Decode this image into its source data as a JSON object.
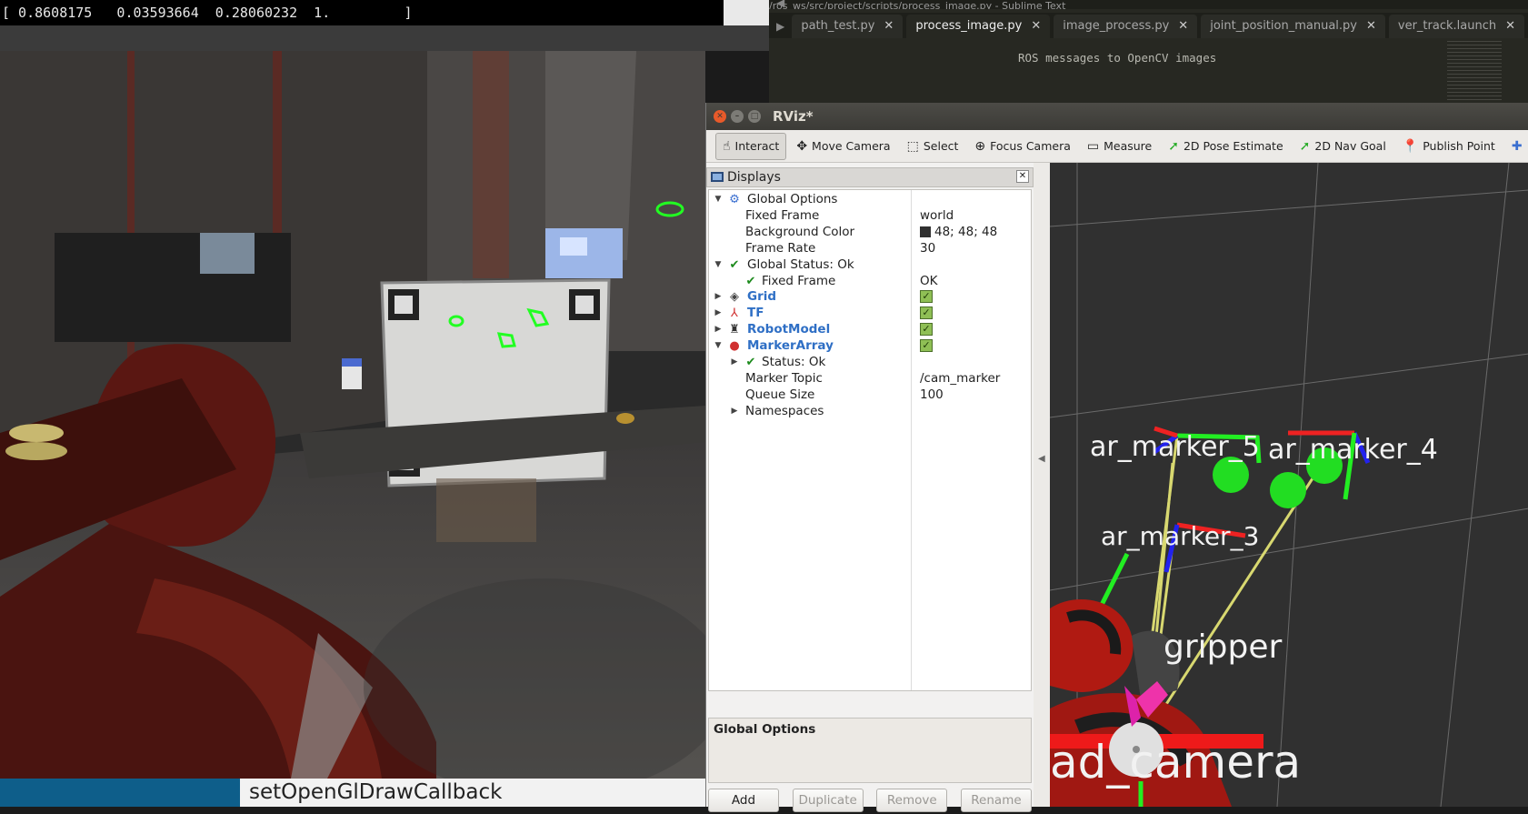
{
  "terminal": {
    "output": "[ 0.8608175   0.03593664  0.28060232  1.         ]"
  },
  "editor": {
    "path": "/ros_ws/src/project/scripts/process_image.py - Sublime Text",
    "tabs": [
      {
        "label": "path_test.py",
        "close": "✕",
        "active": false
      },
      {
        "label": "process_image.py",
        "close": "✕",
        "active": true
      },
      {
        "label": "image_process.py",
        "close": "✕",
        "active": false
      },
      {
        "label": "joint_position_manual.py",
        "close": "✕",
        "active": false
      },
      {
        "label": "ver_track.launch",
        "close": "✕",
        "active": false
      }
    ],
    "nav": "◀ ▶",
    "code_line": "ROS messages to OpenCV images"
  },
  "bottom": {
    "label": "setOpenGlDrawCallback"
  },
  "rviz": {
    "title": "RViz*",
    "window_buttons": {
      "close": "✕",
      "minimize": "–",
      "maximize": "□"
    },
    "toolbar": [
      {
        "id": "interact",
        "label": "Interact",
        "icon": "hand-pointer-icon",
        "glyph": "☝",
        "active": true
      },
      {
        "id": "move-camera",
        "label": "Move Camera",
        "icon": "move-camera-icon",
        "glyph": "✥",
        "active": false
      },
      {
        "id": "select",
        "label": "Select",
        "icon": "select-box-icon",
        "glyph": "⬚",
        "active": false
      },
      {
        "id": "focus-camera",
        "label": "Focus Camera",
        "icon": "focus-crosshair-icon",
        "glyph": "⊕",
        "active": false
      },
      {
        "id": "measure",
        "label": "Measure",
        "icon": "ruler-icon",
        "glyph": "▭",
        "active": false
      },
      {
        "id": "pose-estimate",
        "label": "2D Pose Estimate",
        "icon": "green-arrow-icon",
        "glyph": "➚",
        "active": false
      },
      {
        "id": "nav-goal",
        "label": "2D Nav Goal",
        "icon": "green-arrow-icon",
        "glyph": "➚",
        "active": false
      },
      {
        "id": "publish-point",
        "label": "Publish Point",
        "icon": "map-pin-icon",
        "glyph": "📍",
        "active": false
      },
      {
        "id": "add-tool",
        "label": "",
        "icon": "plus-icon",
        "glyph": "✚",
        "active": false
      }
    ],
    "displays": {
      "title": "Displays",
      "close": "✕",
      "rows": [
        {
          "key": "Global Options",
          "value": "",
          "depth": 0,
          "arrow": "▼",
          "icon": "gear-icon",
          "glyph": "⚙",
          "style": ""
        },
        {
          "key": "Fixed Frame",
          "value": "world",
          "depth": 1,
          "arrow": "",
          "icon": "",
          "glyph": "",
          "style": ""
        },
        {
          "key": "Background Color",
          "value": "48; 48; 48",
          "depth": 1,
          "arrow": "",
          "icon": "",
          "glyph": "",
          "style": "",
          "swatch": "#303030"
        },
        {
          "key": "Frame Rate",
          "value": "30",
          "depth": 1,
          "arrow": "",
          "icon": "",
          "glyph": "",
          "style": ""
        },
        {
          "key": "Global Status: Ok",
          "value": "",
          "depth": 0,
          "arrow": "▼",
          "icon": "check-icon",
          "glyph": "✔",
          "style": ""
        },
        {
          "key": "Fixed Frame",
          "value": "OK",
          "depth": 1,
          "arrow": "",
          "icon": "check-icon",
          "glyph": "✔",
          "style": ""
        },
        {
          "key": "Grid",
          "value": "",
          "depth": 0,
          "arrow": "▶",
          "icon": "grid-icon",
          "glyph": "◈",
          "style": "blue",
          "checked": true
        },
        {
          "key": "TF",
          "value": "",
          "depth": 0,
          "arrow": "▶",
          "icon": "tf-axes-icon",
          "glyph": "⅄",
          "style": "blue",
          "checked": true
        },
        {
          "key": "RobotModel",
          "value": "",
          "depth": 0,
          "arrow": "▶",
          "icon": "robot-icon",
          "glyph": "♜",
          "style": "blue",
          "checked": true
        },
        {
          "key": "MarkerArray",
          "value": "",
          "depth": 0,
          "arrow": "▼",
          "icon": "marker-array-icon",
          "glyph": "●",
          "style": "blue",
          "checked": true
        },
        {
          "key": "Status: Ok",
          "value": "",
          "depth": 1,
          "arrow": "▶",
          "icon": "check-icon",
          "glyph": "✔",
          "style": ""
        },
        {
          "key": "Marker Topic",
          "value": "/cam_marker",
          "depth": 1,
          "arrow": "",
          "icon": "",
          "glyph": "",
          "style": ""
        },
        {
          "key": "Queue Size",
          "value": "100",
          "depth": 1,
          "arrow": "",
          "icon": "",
          "glyph": "",
          "style": ""
        },
        {
          "key": "Namespaces",
          "value": "",
          "depth": 1,
          "arrow": "▶",
          "icon": "",
          "glyph": "",
          "style": ""
        }
      ]
    },
    "description": {
      "title": "Global Options"
    },
    "buttons": [
      {
        "label": "Add",
        "enabled": true
      },
      {
        "label": "Duplicate",
        "enabled": false
      },
      {
        "label": "Remove",
        "enabled": false
      },
      {
        "label": "Rename",
        "enabled": false
      }
    ],
    "splitter_arrow": "◀",
    "viewport": {
      "background": "#303030",
      "labels": [
        "ar_marker_5",
        "ar_marker_4",
        "ar_marker_3",
        "gripper",
        "ad_camera"
      ]
    }
  }
}
